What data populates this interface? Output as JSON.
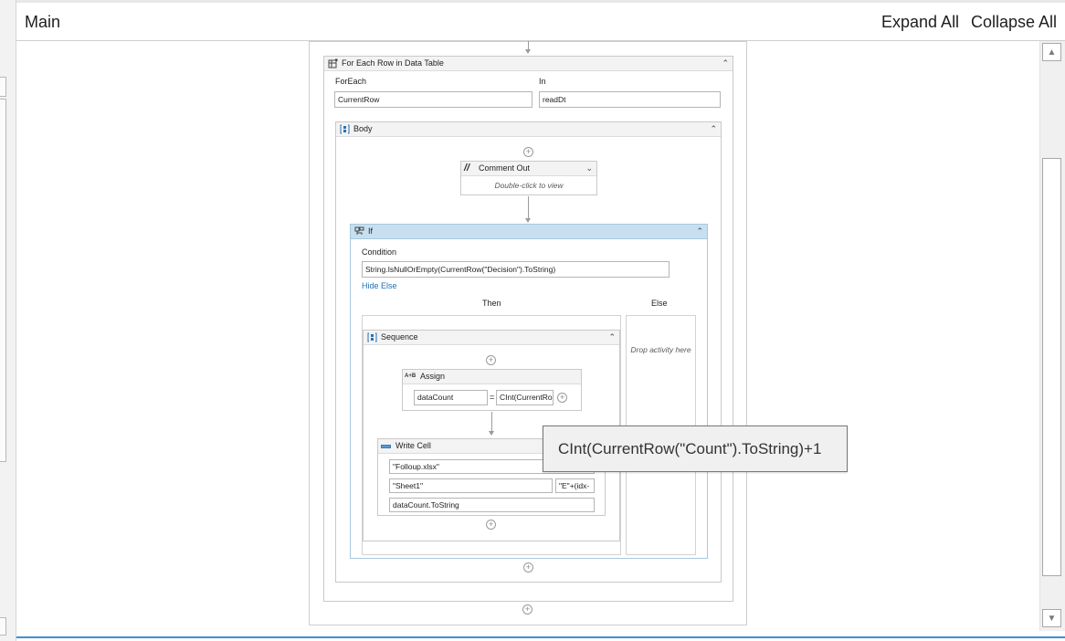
{
  "header": {
    "title": "Main",
    "expand_all": "Expand All",
    "collapse_all": "Collapse All"
  },
  "for_each": {
    "title": "For Each Row in Data Table",
    "foreach_label": "ForEach",
    "foreach_value": "CurrentRow",
    "in_label": "In",
    "in_value": "readDt"
  },
  "body": {
    "title": "Body"
  },
  "comment_out": {
    "title": "Comment Out",
    "hint": "Double-click to view"
  },
  "if_activity": {
    "title": "If",
    "condition_label": "Condition",
    "condition_value": "String.IsNullOrEmpty(CurrentRow(\"Decision\").ToString)",
    "hide_else": "Hide Else",
    "then_label": "Then",
    "else_label": "Else",
    "else_drop_hint": "Drop activity here"
  },
  "sequence": {
    "title": "Sequence"
  },
  "assign": {
    "title": "Assign",
    "icon_text": "A+B",
    "left_value": "dataCount",
    "equals": "=",
    "right_value": "CInt(CurrentRo"
  },
  "write_cell": {
    "title": "Write Cell",
    "workbook": "\"Folloup.xlsx\"",
    "sheet": "\"Sheet1\"",
    "range": "\"E\"+(idx-",
    "value": "dataCount.ToString"
  },
  "tooltip": {
    "text": "CInt(CurrentRow(\"Count\").ToString)+1"
  },
  "colors": {
    "if_header": "#c7dfef",
    "accent_line": "#3c8fd7",
    "link": "#1f6fb5"
  }
}
